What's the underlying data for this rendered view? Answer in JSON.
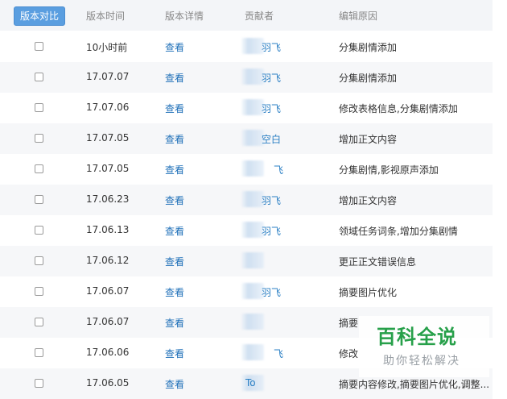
{
  "toolbar": {
    "compare_label": "版本对比"
  },
  "columns": {
    "time": "版本时间",
    "detail": "版本详情",
    "contributor": "贡献者",
    "reason": "编辑原因"
  },
  "rows": [
    {
      "time": "10小时前",
      "view": "查看",
      "contributor": "羽飞",
      "reason": "分集剧情添加"
    },
    {
      "time": "17.07.07",
      "view": "查看",
      "contributor": "羽飞",
      "reason": "分集剧情添加"
    },
    {
      "time": "17.07.06",
      "view": "查看",
      "contributor": "羽飞",
      "reason": "修改表格信息,分集剧情添加"
    },
    {
      "time": "17.07.05",
      "view": "查看",
      "contributor": "空白",
      "reason": "增加正文内容"
    },
    {
      "time": "17.07.05",
      "view": "查看",
      "contributor": "飞",
      "reason": "分集剧情,影视原声添加"
    },
    {
      "time": "17.06.23",
      "view": "查看",
      "contributor": "羽飞",
      "reason": "增加正文内容"
    },
    {
      "time": "17.06.13",
      "view": "查看",
      "contributor": "羽飞",
      "reason": "领域任务词条,增加分集剧情"
    },
    {
      "time": "17.06.12",
      "view": "查看",
      "contributor": "",
      "reason": "更正正文错误信息"
    },
    {
      "time": "17.06.07",
      "view": "查看",
      "contributor": "羽飞",
      "reason": "摘要图片优化"
    },
    {
      "time": "17.06.07",
      "view": "查看",
      "contributor": "",
      "reason": "摘要"
    },
    {
      "time": "17.06.06",
      "view": "查看",
      "contributor": "飞",
      "reason": "修改"
    },
    {
      "time": "17.06.05",
      "view": "查看",
      "contributor": "To",
      "reason": "摘要内容修改,摘要图片优化,调整..."
    }
  ],
  "watermark": {
    "title": "百科全说",
    "subtitle": "助你轻松解决"
  }
}
